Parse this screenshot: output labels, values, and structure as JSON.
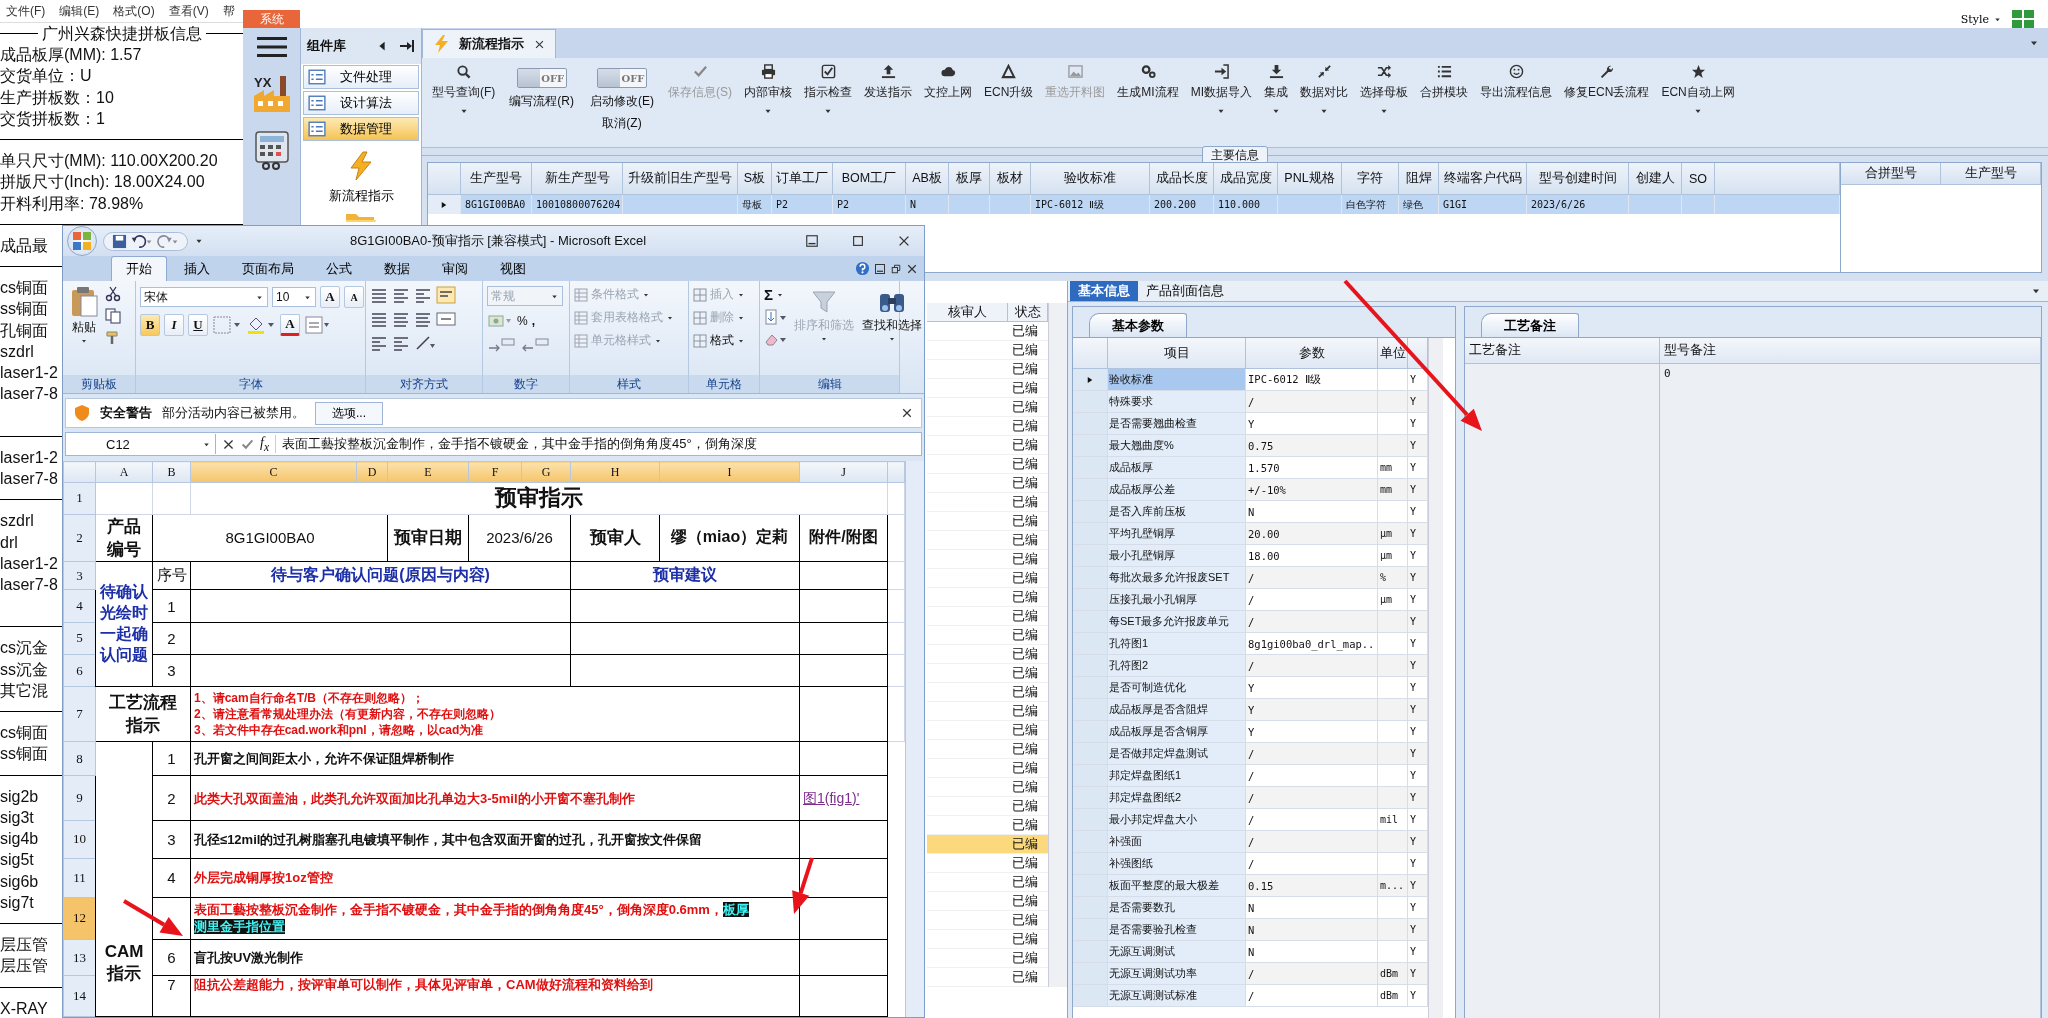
{
  "notepad": {
    "menu": [
      "文件(F)",
      "编辑(E)",
      "格式(O)",
      "查看(V)",
      "帮"
    ],
    "lines": [
      {
        "kind": "title",
        "text": "广州兴森快捷拼板信息"
      },
      {
        "kind": "text",
        "text": "成品板厚(MM): 1.57"
      },
      {
        "kind": "text",
        "text": "交货单位：U"
      },
      {
        "kind": "text",
        "text": "生产拼板数：10"
      },
      {
        "kind": "text",
        "text": "交货拼板数：1"
      },
      {
        "kind": "rule"
      },
      {
        "kind": "text",
        "text": "单只尺寸(MM): 110.00X200.20"
      },
      {
        "kind": "text",
        "text": "拼版尺寸(Inch): 18.00X24.00"
      },
      {
        "kind": "text",
        "text": "开料利用率: 78.98%"
      },
      {
        "kind": "rule"
      },
      {
        "kind": "text",
        "text": "成品最"
      },
      {
        "kind": "rule"
      },
      {
        "kind": "text",
        "text": "cs铜面"
      },
      {
        "kind": "text",
        "text": "ss铜面"
      },
      {
        "kind": "text",
        "text": "孔铜面"
      },
      {
        "kind": "text",
        "text": "szdrl"
      },
      {
        "kind": "text",
        "text": "laser1-2"
      },
      {
        "kind": "text",
        "text": "laser7-8"
      },
      {
        "kind": "blank"
      },
      {
        "kind": "rule"
      },
      {
        "kind": "text",
        "text": "laser1-2"
      },
      {
        "kind": "text",
        "text": "laser7-8"
      },
      {
        "kind": "rule"
      },
      {
        "kind": "text",
        "text": "szdrl"
      },
      {
        "kind": "text",
        "text": "drl"
      },
      {
        "kind": "text",
        "text": "laser1-2"
      },
      {
        "kind": "text",
        "text": "laser7-8"
      },
      {
        "kind": "blank"
      },
      {
        "kind": "rule"
      },
      {
        "kind": "text",
        "text": "cs沉金"
      },
      {
        "kind": "text",
        "text": "ss沉金"
      },
      {
        "kind": "text",
        "text": "其它混"
      },
      {
        "kind": "rule"
      },
      {
        "kind": "text",
        "text": "cs铜面"
      },
      {
        "kind": "text",
        "text": "ss铜面"
      },
      {
        "kind": "rule"
      },
      {
        "kind": "text",
        "text": "sig2b"
      },
      {
        "kind": "text",
        "text": "sig3t"
      },
      {
        "kind": "text",
        "text": "sig4b"
      },
      {
        "kind": "text",
        "text": "sig5t"
      },
      {
        "kind": "text",
        "text": "sig6b"
      },
      {
        "kind": "text",
        "text": "sig7t"
      },
      {
        "kind": "rule"
      },
      {
        "kind": "text",
        "text": "层压管"
      },
      {
        "kind": "text",
        "text": "层压管"
      },
      {
        "kind": "rule"
      },
      {
        "kind": "text",
        "text": "X-RAY"
      }
    ]
  },
  "app": {
    "system_tab": "系统",
    "style_menu": "Style",
    "logo_text": "YX",
    "component_panel": {
      "title": "组件库",
      "items": [
        {
          "label": "文件处理",
          "selected": false
        },
        {
          "label": "设计算法",
          "selected": false
        },
        {
          "label": "数据管理",
          "selected": true
        }
      ],
      "tool": "新流程指示"
    },
    "doc_tab": "新流程指示",
    "toolbar": [
      {
        "kind": "button",
        "label": "型号查询(F)",
        "dropdown": true,
        "disabled": false
      },
      {
        "kind": "toggle",
        "label": "编写流程(R)",
        "state_text": "OFF",
        "on": false
      },
      {
        "kind": "toggle",
        "label": "启动修改(E)",
        "sub_label": "取消(Z)",
        "state_text": "OFF",
        "on": false
      },
      {
        "kind": "button",
        "label": "保存信息(S)",
        "dropdown": false,
        "disabled": true
      },
      {
        "kind": "button",
        "label": "内部审核",
        "dropdown": true,
        "disabled": false
      },
      {
        "kind": "button",
        "label": "指示检查",
        "dropdown": true,
        "disabled": false
      },
      {
        "kind": "button",
        "label": "发送指示",
        "dropdown": false,
        "disabled": false
      },
      {
        "kind": "button",
        "label": "文控上网",
        "dropdown": false,
        "disabled": false
      },
      {
        "kind": "button",
        "label": "ECN升级",
        "dropdown": false,
        "disabled": false
      },
      {
        "kind": "button",
        "label": "重选开料图",
        "dropdown": false,
        "disabled": true
      },
      {
        "kind": "button",
        "label": "生成MI流程",
        "dropdown": false,
        "disabled": false
      },
      {
        "kind": "button",
        "label": "MI数据导入",
        "dropdown": true,
        "disabled": false
      },
      {
        "kind": "button",
        "label": "集成",
        "dropdown": true,
        "disabled": false
      },
      {
        "kind": "button",
        "label": "数据对比",
        "dropdown": true,
        "disabled": false
      },
      {
        "kind": "button",
        "label": "选择母板",
        "dropdown": true,
        "disabled": false
      },
      {
        "kind": "button",
        "label": "合拼模块",
        "dropdown": false,
        "disabled": false
      },
      {
        "kind": "button",
        "label": "导出流程信息",
        "dropdown": false,
        "disabled": false
      },
      {
        "kind": "button",
        "label": "修复ECN丢流程",
        "dropdown": false,
        "disabled": false
      },
      {
        "kind": "button",
        "label": "ECN自动上网",
        "dropdown": true,
        "disabled": false
      }
    ],
    "main_info": {
      "title": "主要信息",
      "columns": [
        "生产型号",
        "新生产型号",
        "升级前旧生产型号",
        "S板",
        "订单工厂",
        "BOM工厂",
        "AB板",
        "板厚",
        "板材",
        "验收标准",
        "成品长度",
        "成品宽度",
        "PNL规格",
        "字符",
        "阻焊",
        "终端客户代码",
        "型号创建时间",
        "创建人",
        "SO"
      ],
      "rows": [
        {
          "selected": true,
          "cells": [
            "8G1GI00BA0",
            "10010800076204",
            "",
            "母板",
            "P2",
            "P2",
            "N",
            "",
            "",
            "IPC-6012 Ⅱ级",
            "200.200",
            "110.000",
            "",
            "白色字符",
            "绿色",
            "G1GI",
            "2023/6/26",
            "",
            ""
          ]
        }
      ],
      "side_columns": [
        "合拼型号",
        "生产型号"
      ]
    },
    "review_list": {
      "columns": [
        "核审人",
        "状态"
      ],
      "rows": [
        {
          "status": "已编",
          "selected": false
        },
        {
          "status": "已编",
          "selected": false
        },
        {
          "status": "已编",
          "selected": false
        },
        {
          "status": "已编",
          "selected": false
        },
        {
          "status": "已编",
          "selected": false
        },
        {
          "status": "已编",
          "selected": false
        },
        {
          "status": "已编",
          "selected": false
        },
        {
          "status": "已编",
          "selected": false
        },
        {
          "status": "已编",
          "selected": false
        },
        {
          "status": "已编",
          "selected": false
        },
        {
          "status": "已编",
          "selected": false
        },
        {
          "status": "已编",
          "selected": false
        },
        {
          "status": "已编",
          "selected": false
        },
        {
          "status": "已编",
          "selected": false
        },
        {
          "status": "已编",
          "selected": false
        },
        {
          "status": "已编",
          "selected": false
        },
        {
          "status": "已编",
          "selected": false
        },
        {
          "status": "已编",
          "selected": false
        },
        {
          "status": "已编",
          "selected": false
        },
        {
          "status": "已编",
          "selected": false
        },
        {
          "status": "已编",
          "selected": false
        },
        {
          "status": "已编",
          "selected": false
        },
        {
          "status": "已编",
          "selected": false
        },
        {
          "status": "已编",
          "selected": false
        },
        {
          "status": "已编",
          "selected": false
        },
        {
          "status": "已编",
          "selected": false
        },
        {
          "status": "已编",
          "selected": false
        },
        {
          "status": "已编",
          "selected": true
        },
        {
          "status": "已编",
          "selected": false
        },
        {
          "status": "已编",
          "selected": false
        },
        {
          "status": "已编",
          "selected": false
        },
        {
          "status": "已编",
          "selected": false
        },
        {
          "status": "已编",
          "selected": false
        },
        {
          "status": "已编",
          "selected": false
        },
        {
          "status": "已编",
          "selected": false
        }
      ]
    },
    "detail": {
      "tabs": [
        {
          "label": "基本信息",
          "selected": true
        },
        {
          "label": "产品剖面信息",
          "selected": false
        }
      ],
      "params": {
        "tab": "基本参数",
        "columns": [
          "项目",
          "参数",
          "单位"
        ],
        "rows": [
          {
            "item": "验收标准",
            "value": "IPC-6012 Ⅱ级",
            "unit": "",
            "flag": "Y",
            "selected": true
          },
          {
            "item": "特殊要求",
            "value": "/",
            "unit": "",
            "flag": "Y",
            "selected": false
          },
          {
            "item": "是否需要翘曲检查",
            "value": "Y",
            "unit": "",
            "flag": "Y",
            "selected": false
          },
          {
            "item": "最大翘曲度%",
            "value": "0.75",
            "unit": "",
            "flag": "Y",
            "selected": false
          },
          {
            "item": "成品板厚",
            "value": "1.570",
            "unit": "mm",
            "flag": "Y",
            "selected": false
          },
          {
            "item": "成品板厚公差",
            "value": "+/-10%",
            "unit": "mm",
            "flag": "Y",
            "selected": false
          },
          {
            "item": "是否入库前压板",
            "value": "N",
            "unit": "",
            "flag": "Y",
            "selected": false
          },
          {
            "item": "平均孔壁铜厚",
            "value": "20.00",
            "unit": "μm",
            "flag": "Y",
            "selected": false
          },
          {
            "item": "最小孔壁铜厚",
            "value": "18.00",
            "unit": "μm",
            "flag": "Y",
            "selected": false
          },
          {
            "item": "每批次最多允许报废SET",
            "value": "/",
            "unit": "%",
            "flag": "Y",
            "selected": false
          },
          {
            "item": "压接孔最小孔铜厚",
            "value": "/",
            "unit": "μm",
            "flag": "Y",
            "selected": false
          },
          {
            "item": "每SET最多允许报废单元",
            "value": "/",
            "unit": "",
            "flag": "Y",
            "selected": false
          },
          {
            "item": "孔符图1",
            "value": "8g1gi00ba0_drl_map...",
            "unit": "",
            "flag": "Y",
            "selected": false
          },
          {
            "item": "孔符图2",
            "value": "/",
            "unit": "",
            "flag": "Y",
            "selected": false
          },
          {
            "item": "是否可制造优化",
            "value": "Y",
            "unit": "",
            "flag": "Y",
            "selected": false
          },
          {
            "item": "成品板厚是否含阻焊",
            "value": "Y",
            "unit": "",
            "flag": "Y",
            "selected": false
          },
          {
            "item": "成品板厚是否含铜厚",
            "value": "Y",
            "unit": "",
            "flag": "Y",
            "selected": false
          },
          {
            "item": "是否做邦定焊盘测试",
            "value": "/",
            "unit": "",
            "flag": "Y",
            "selected": false
          },
          {
            "item": "邦定焊盘图纸1",
            "value": "/",
            "unit": "",
            "flag": "Y",
            "selected": false
          },
          {
            "item": "邦定焊盘图纸2",
            "value": "/",
            "unit": "",
            "flag": "Y",
            "selected": false
          },
          {
            "item": "最小邦定焊盘大小",
            "value": "/",
            "unit": "mil",
            "flag": "Y",
            "selected": false
          },
          {
            "item": "补强面",
            "value": "/",
            "unit": "",
            "flag": "Y",
            "selected": false
          },
          {
            "item": "补强图纸",
            "value": "/",
            "unit": "",
            "flag": "Y",
            "selected": false
          },
          {
            "item": "板面平整度的最大极差",
            "value": "0.15",
            "unit": "m...",
            "flag": "Y",
            "selected": false
          },
          {
            "item": "是否需要数孔",
            "value": "N",
            "unit": "",
            "flag": "Y",
            "selected": false
          },
          {
            "item": "是否需要验孔检查",
            "value": "N",
            "unit": "",
            "flag": "Y",
            "selected": false
          },
          {
            "item": "无源互调测试",
            "value": "N",
            "unit": "",
            "flag": "Y",
            "selected": false
          },
          {
            "item": "无源互调测试功率",
            "value": "/",
            "unit": "dBm",
            "flag": "Y",
            "selected": false
          },
          {
            "item": "无源互调测试标准",
            "value": "/",
            "unit": "dBm",
            "flag": "Y",
            "selected": false
          }
        ]
      },
      "notes": {
        "tab": "工艺备注",
        "columns": [
          {
            "label": "工艺备注"
          },
          {
            "label": "型号备注",
            "value": "0"
          }
        ]
      }
    }
  },
  "excel": {
    "title": "8G1GI00BA0-预审指示  [兼容模式] - Microsoft Excel",
    "tabs": [
      {
        "label": "开始",
        "selected": true
      },
      {
        "label": "插入",
        "selected": false
      },
      {
        "label": "页面布局",
        "selected": false
      },
      {
        "label": "公式",
        "selected": false
      },
      {
        "label": "数据",
        "selected": false
      },
      {
        "label": "审阅",
        "selected": false
      },
      {
        "label": "视图",
        "selected": false
      }
    ],
    "ribbon": {
      "paste": "粘贴",
      "font_name": "宋体",
      "font_size": "10",
      "grow": "A",
      "shrink": "A",
      "bold": "B",
      "italic": "I",
      "underline": "U",
      "font_color": "A",
      "number_format": "常规",
      "percent": "%",
      "comma": ",",
      "sum": "Σ",
      "styles": [
        {
          "label": "条件格式",
          "disabled": true
        },
        {
          "label": "套用表格格式",
          "disabled": true
        },
        {
          "label": "单元格样式",
          "disabled": true
        }
      ],
      "cells": [
        {
          "label": "插入",
          "disabled": true
        },
        {
          "label": "删除",
          "disabled": true
        },
        {
          "label": "格式",
          "disabled": false
        }
      ],
      "sort": {
        "label": "排序和筛选",
        "disabled": true
      },
      "find": {
        "label": "查找和选择",
        "disabled": false
      },
      "groups": [
        "剪贴板",
        "字体",
        "对齐方式",
        "数字",
        "样式",
        "单元格",
        "编辑"
      ]
    },
    "security": {
      "title": "安全警告",
      "message": "部分活动内容已被禁用。",
      "button": "选项..."
    },
    "formula": {
      "name_box": "C12",
      "fx": "f$_{x}$",
      "content": "表面工藝按整板沉金制作，金手指不镀硬金，其中金手指的倒角角度45°，倒角深度"
    },
    "columns": [
      {
        "label": "A",
        "selected": false
      },
      {
        "label": "B",
        "selected": false
      },
      {
        "label": "C",
        "selected": true
      },
      {
        "label": "D",
        "selected": true
      },
      {
        "label": "E",
        "selected": true
      },
      {
        "label": "F",
        "selected": true
      },
      {
        "label": "G",
        "selected": true
      },
      {
        "label": "H",
        "selected": true
      },
      {
        "label": "I",
        "selected": true
      },
      {
        "label": "J",
        "selected": false
      }
    ],
    "row_numbers": [
      {
        "label": "1",
        "selected": false
      },
      {
        "label": "2",
        "selected": false
      },
      {
        "label": "3",
        "selected": false
      },
      {
        "label": "4",
        "selected": false
      },
      {
        "label": "5",
        "selected": false
      },
      {
        "label": "6",
        "selected": false
      },
      {
        "label": "7",
        "selected": false
      },
      {
        "label": "8",
        "selected": false
      },
      {
        "label": "9",
        "selected": false
      },
      {
        "label": "10",
        "selected": false
      },
      {
        "label": "11",
        "selected": false
      },
      {
        "label": "12",
        "selected": true
      },
      {
        "label": "13",
        "selected": false
      },
      {
        "label": "14",
        "selected": false
      }
    ],
    "sheet": {
      "title": "预审指示",
      "product_label": "产品编号",
      "product_no": "8G1GI00BA0",
      "date_label": "预审日期",
      "date": "2023/6/26",
      "reviewer_label": "预审人",
      "reviewer": "缪（miao）定莉",
      "attachment_label": "附件/附图",
      "confirm_label": "待确认光绘时一起确认问题",
      "seq_label": "序号",
      "question_label": "待与客户确认问题(原因与内容)",
      "advice_label": "预审建议",
      "confirm_rows": [
        "1",
        "2",
        "3"
      ],
      "process_label": "工艺流程指示",
      "process_lines": [
        "1、请cam自行命名T/B（不存在则忽略）；",
        "2、请注意看常规处理办法（有更新内容，不存在则忽略）",
        "3、若文件中存在cad.work和pnl，请忽略，以cad为准"
      ],
      "cam_label": "CAM指示",
      "cam_items": [
        {
          "no": "1",
          "text": "孔开窗之间间距太小，允许不保证阻焊桥制作",
          "color": "#111111"
        },
        {
          "no": "2",
          "text": "此类大孔双面盖油，此类孔允许双面加比孔单边大3-5mil的小开窗不塞孔制作",
          "color": "#e01010",
          "attachment": "图1(fig1)'"
        },
        {
          "no": "3",
          "text": "孔径≤12mil的过孔树脂塞孔电镀填平制作，其中包含双面开窗的过孔，孔开窗按文件保留",
          "color": "#111111"
        },
        {
          "no": "4",
          "text": "外层完成铜厚按1oz管控",
          "color": "#e01010"
        },
        {
          "text": "表面工藝按整板沉金制作，金手指不镀硬金，其中金手指的倒角角度45°，倒角深度0.6mm，",
          "highlight": [
            "板厚",
            "测里金手指位置"
          ],
          "color": "#e01010"
        },
        {
          "no": "6",
          "text": "盲孔按UV激光制作",
          "color": "#111111"
        },
        {
          "no": "7",
          "text": "阻抗公差超能力，按评审单可以制作，具体见评审单，CAM做好流程和资料给到",
          "color": "#e01010"
        }
      ]
    }
  }
}
